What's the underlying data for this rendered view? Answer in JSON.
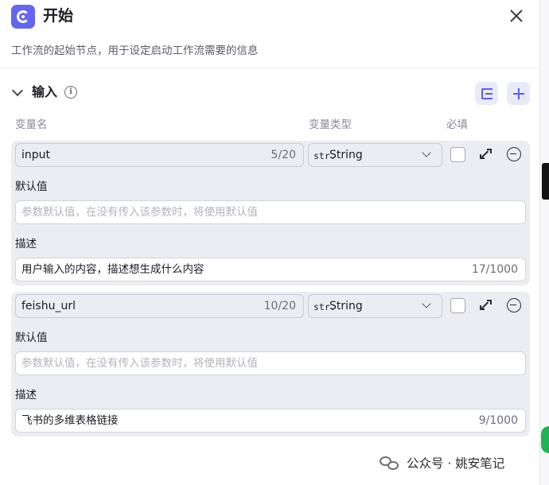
{
  "header": {
    "title": "开始",
    "description": "工作流的起始节点，用于设定启动工作流需要的信息"
  },
  "section": {
    "title": "输入",
    "info_icon": "info-circle-icon",
    "import_icon": "import-icon",
    "add_icon": "plus-icon"
  },
  "columns": {
    "name": "变量名",
    "type": "变量类型",
    "required": "必填"
  },
  "variables": [
    {
      "name": "input",
      "name_count": "5/20",
      "type_prefix": "str.",
      "type": "String",
      "required": false,
      "default_label": "默认值",
      "default_placeholder": "参数默认值，在没有传入该参数时，将使用默认值",
      "desc_label": "描述",
      "description": "用户输入的内容，描述想生成什么内容",
      "desc_count": "17/1000"
    },
    {
      "name": "feishu_url",
      "name_count": "10/20",
      "type_prefix": "str.",
      "type": "String",
      "required": false,
      "default_label": "默认值",
      "default_placeholder": "参数默认值，在没有传入该参数时，将使用默认值",
      "desc_label": "描述",
      "description": "飞书的多维表格链接",
      "desc_count": "9/1000"
    }
  ],
  "watermark": {
    "text": "公众号 · 姚安笔记"
  },
  "colors": {
    "accent": "#6366f1",
    "card_bg": "#ececf3",
    "button_bg": "#e9eaf7"
  }
}
